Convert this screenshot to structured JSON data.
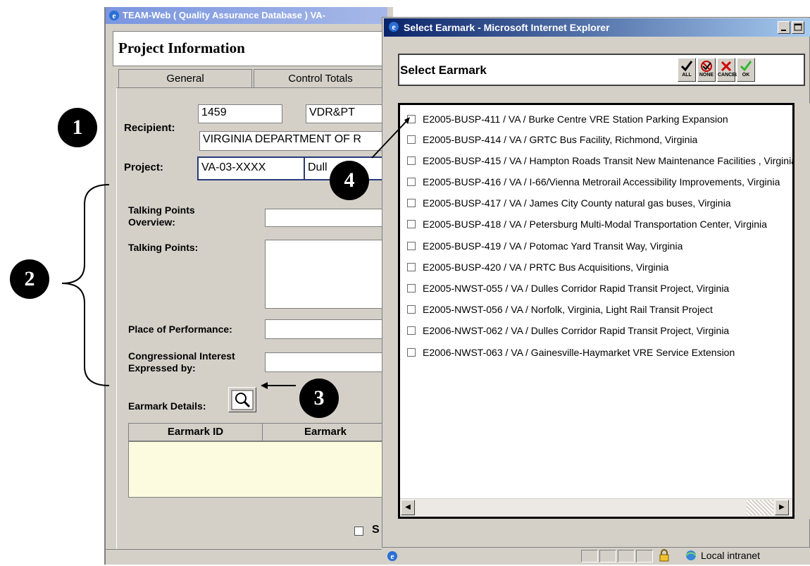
{
  "background_window": {
    "title": "TEAM-Web ( Quality Assurance Database ) VA-",
    "header": "Project Information",
    "tabs": [
      {
        "label": "General"
      },
      {
        "label": "Control Totals"
      }
    ],
    "recipient": {
      "label": "Recipient:",
      "id": "1459",
      "code": "VDR&PT",
      "name": "VIRGINIA DEPARTMENT OF R"
    },
    "project": {
      "label": "Project:",
      "number": "VA-03-XXXX",
      "name": "Dull"
    },
    "talking_points_overview": {
      "label_line1": "Talking Points",
      "label_line2": "Overview:"
    },
    "talking_points": {
      "label": "Talking Points:"
    },
    "place_of_performance": {
      "label": "Place of Performance:"
    },
    "congressional_interest": {
      "label_line1": "Congressional Interest",
      "label_line2": "Expressed by:"
    },
    "earmark_details": {
      "label": "Earmark Details:",
      "columns": [
        "Earmark ID",
        "Earmark"
      ]
    },
    "bottom_checkbox_label": "S"
  },
  "popup": {
    "title": "Select Earmark - Microsoft Internet Explorer",
    "header": "Select Earmark",
    "toolbar": [
      {
        "label": "ALL",
        "icon": "check-icon"
      },
      {
        "label": "NONE",
        "icon": "none-icon"
      },
      {
        "label": "CANCEL",
        "icon": "x-icon"
      },
      {
        "label": "OK",
        "icon": "ok-check-icon"
      }
    ],
    "earmarks": [
      {
        "label": "E2005-BUSP-411 / VA / Burke Centre VRE Station Parking Expansion"
      },
      {
        "label": "E2005-BUSP-414 / VA / GRTC Bus Facility, Richmond, Virginia"
      },
      {
        "label": "E2005-BUSP-415 / VA / Hampton Roads Transit New Maintenance Facilities , Virginia"
      },
      {
        "label": "E2005-BUSP-416 / VA / I-66/Vienna Metrorail Accessibility Improvements, Virginia"
      },
      {
        "label": "E2005-BUSP-417 / VA / James City County natural gas buses, Virginia"
      },
      {
        "label": "E2005-BUSP-418 / VA / Petersburg Multi-Modal Transportation Center, Virginia"
      },
      {
        "label": "E2005-BUSP-419 / VA / Potomac Yard Transit Way, Virginia"
      },
      {
        "label": "E2005-BUSP-420 / VA / PRTC Bus Acquisitions, Virginia"
      },
      {
        "label": "E2005-NWST-055 / VA / Dulles Corridor Rapid Transit Project, Virginia"
      },
      {
        "label": "E2005-NWST-056 / VA / Norfolk, Virginia, Light Rail Transit Project"
      },
      {
        "label": "E2006-NWST-062 / VA / Dulles Corridor Rapid Transit Project, Virginia"
      },
      {
        "label": "E2006-NWST-063 / VA / Gainesville-Haymarket VRE Service Extension"
      }
    ],
    "status": {
      "zone": "Local intranet"
    }
  },
  "callouts": [
    {
      "label": "1"
    },
    {
      "label": "2"
    },
    {
      "label": "3"
    },
    {
      "label": "4"
    }
  ],
  "colors": {
    "popup_title_start": "#0a246a",
    "popup_title_end": "#a6caf0",
    "bg_title_start": "#7a96df",
    "earmark_table_body": "#fcfbe0",
    "window_face": "#d4d0c8"
  }
}
